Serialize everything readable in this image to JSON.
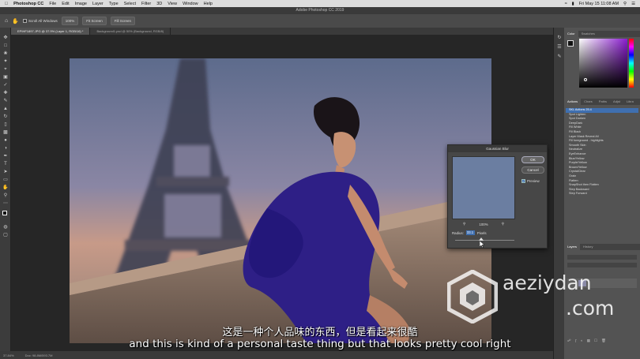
{
  "menubar": {
    "app_name": "Photoshop CC",
    "menus": [
      "File",
      "Edit",
      "Image",
      "Layer",
      "Type",
      "Select",
      "Filter",
      "3D",
      "View",
      "Window",
      "Help"
    ],
    "clock": "Fri May 15 11:08 AM"
  },
  "window_title": "Adobe Photoshop CC 2019",
  "optionsbar": {
    "scroll_all_windows": "Scroll All Windows",
    "zoom_100": "100%",
    "fit_screen": "Fit Screen",
    "fill_screen": "Fill Screen"
  },
  "tabs": [
    {
      "label": "EPIHF1897.JPG @ 37.9% (Layer 1, RGB/16) *",
      "active": true
    },
    {
      "label": "Background1.psd @ 50% (Background, RGB/8)",
      "active": false
    }
  ],
  "statusbar": {
    "zoom": "37.84%",
    "doc": "Doc: 98.8M/593.7M"
  },
  "panels": {
    "color_tabs": [
      "Color",
      "Swatches"
    ],
    "actions_tabs": [
      "Actions",
      "Chars",
      "Paths",
      "Adjst",
      "Libra"
    ],
    "layers_tabs": [
      "Layers",
      "History"
    ],
    "actions": [
      {
        "label": "SKL Actions 25.4",
        "selected": true
      },
      {
        "label": "Spot Lighten",
        "selected": false
      },
      {
        "label": "Spot Darken",
        "selected": false
      },
      {
        "label": "DeepDark",
        "selected": false
      },
      {
        "label": "Fill White",
        "selected": false
      },
      {
        "label": "Fill Black",
        "selected": false
      },
      {
        "label": "Layer Mask Reveal All",
        "selected": false
      },
      {
        "label": "Fill foreground - highlights",
        "selected": false
      },
      {
        "label": "Smooth Skin",
        "selected": false
      },
      {
        "label": "Neutralize",
        "selected": false
      },
      {
        "label": "EyeEnhance",
        "selected": false
      },
      {
        "label": "Blue/Yellow",
        "selected": false
      },
      {
        "label": "Purple/Yellow",
        "selected": false
      },
      {
        "label": "Brown/Yellow",
        "selected": false
      },
      {
        "label": "CrystalClear",
        "selected": false
      },
      {
        "label": "Grain",
        "selected": false
      },
      {
        "label": "Flatten",
        "selected": false
      },
      {
        "label": "SnapShot then Flatten",
        "selected": false
      },
      {
        "label": "Step Backward",
        "selected": false
      },
      {
        "label": "Step Forward",
        "selected": false
      }
    ]
  },
  "dialog": {
    "title": "Gaussian Blur",
    "ok_label": "OK",
    "cancel_label": "Cancel",
    "preview_label": "Preview",
    "preview_checked": true,
    "zoom_label": "100%",
    "radius_label": "Radius:",
    "radius_value": "33.1",
    "units_label": "Pixels",
    "slider_fraction": 0.44
  },
  "subtitles": {
    "chinese": "这是一种个人品味的东西，但是看起来很酷",
    "english": "and this is kind of a personal taste thing but that looks pretty cool right"
  },
  "watermark": {
    "line1": "aeziydan",
    "line2": ".com"
  },
  "colors": {
    "selection_blue": "#3f6fb0",
    "panel_bg": "#535353",
    "app_bg": "#262626"
  }
}
